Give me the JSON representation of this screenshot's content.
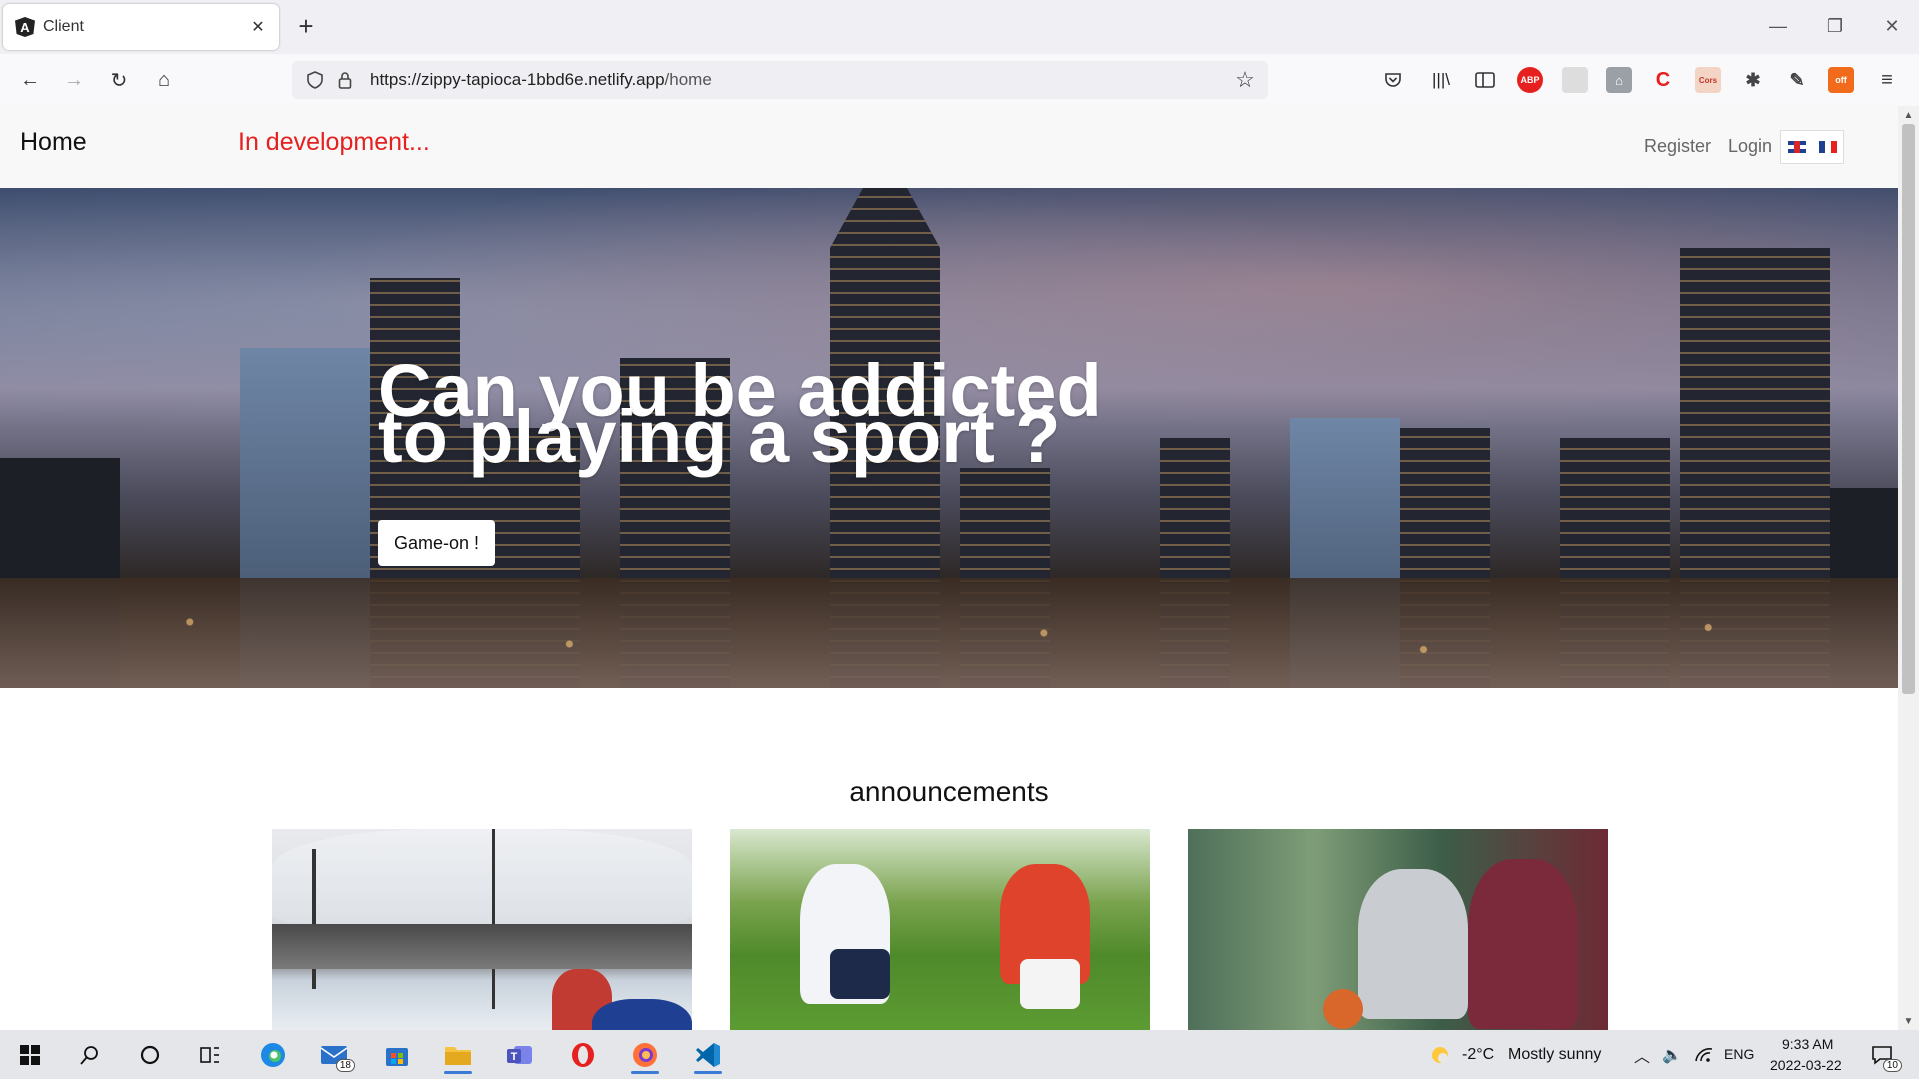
{
  "browser": {
    "tab_title": "Client",
    "tab_close": "✕",
    "new_tab": "+",
    "url_scheme_host": "https://zippy-tapioca-1bbd6e.netlify.app",
    "url_path": "/home",
    "window_controls": {
      "minimize": "—",
      "restore": "❐",
      "close": "✕"
    },
    "nav": {
      "back": "←",
      "forward": "→",
      "reload": "↻",
      "home": "⌂"
    },
    "extensions": {
      "abp": "ABP",
      "cors": "Cors",
      "off": "off",
      "c": "C"
    }
  },
  "site": {
    "brand": "Home",
    "dev_note": "In development...",
    "nav_links": {
      "register": "Register",
      "login": "Login"
    },
    "languages": [
      "en",
      "fr"
    ]
  },
  "hero": {
    "title_line1": "Can you be addicted",
    "title_line2": "to playing a sport ?",
    "button": "Game-on !"
  },
  "announcements": {
    "heading": "announcements",
    "cards": [
      {
        "topic": "hockey-outdoor-rink"
      },
      {
        "topic": "soccer"
      },
      {
        "topic": "basketball"
      }
    ]
  },
  "taskbar": {
    "mail_badge": "18",
    "notification_badge": "10",
    "weather_temp": "-2°C",
    "weather_text": "Mostly sunny",
    "language": "ENG",
    "time": "9:33 AM",
    "date": "2022-03-22"
  },
  "colors": {
    "dev_note": "#e5201e",
    "taskbar_accent": "#3a7bd5"
  }
}
